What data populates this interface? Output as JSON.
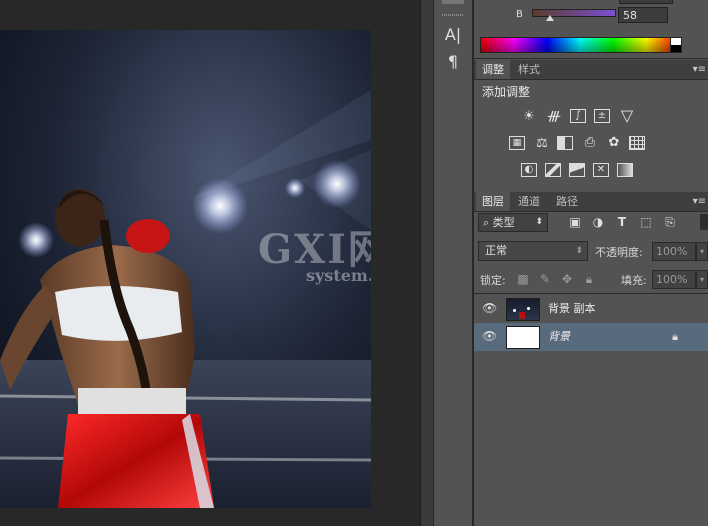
{
  "color_panel": {
    "channel_label": "B",
    "channel_value": "58"
  },
  "adjustments": {
    "tabs": [
      "调整",
      "样式"
    ],
    "title": "添加调整",
    "icons_row1": [
      "brightness-contrast-icon",
      "levels-icon",
      "curves-icon",
      "exposure-icon",
      "vibrance-icon"
    ],
    "icons_row2": [
      "hue-saturation-icon",
      "color-balance-icon",
      "black-white-icon",
      "photo-filter-icon",
      "channel-mixer-icon",
      "color-lookup-icon"
    ],
    "icons_row3": [
      "invert-icon",
      "posterize-icon",
      "threshold-icon",
      "selective-color-icon",
      "gradient-map-icon"
    ]
  },
  "layers_panel": {
    "tabs": [
      "图层",
      "通道",
      "路径"
    ],
    "filter_label": "类型",
    "blend_mode": "正常",
    "opacity_label": "不透明度:",
    "opacity_value": "100%",
    "lock_label": "锁定:",
    "fill_label": "填充:",
    "fill_value": "100%",
    "layers": [
      {
        "name": "背景 副本",
        "visible": true,
        "locked": false,
        "selected": false
      },
      {
        "name": "背景",
        "visible": true,
        "locked": true,
        "selected": true
      }
    ]
  },
  "watermark": {
    "line1": "GXI网",
    "line2": "system.com"
  },
  "colors": {
    "panel_bg": "#535353",
    "workspace_bg": "#282828",
    "selected_row": "#586b7d"
  }
}
